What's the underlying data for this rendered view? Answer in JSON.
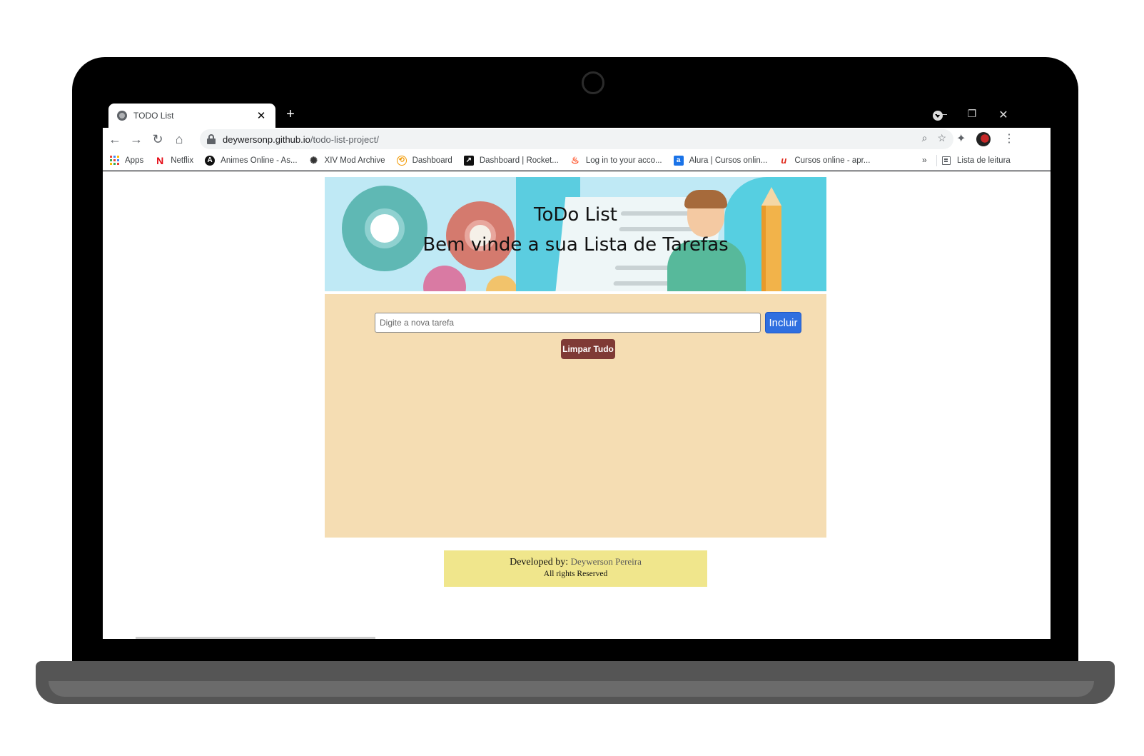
{
  "browser": {
    "tab_title": "TODO List",
    "url_host": "deywersonp.github.io",
    "url_path": "/todo-list-project/",
    "bookmarks": [
      {
        "label": "Apps",
        "icon": "apps-grid-icon"
      },
      {
        "label": "Netflix",
        "icon": "netflix-icon",
        "color": "#e50914"
      },
      {
        "label": "Animes Online - As...",
        "icon": "anime-icon",
        "color": "#111111"
      },
      {
        "label": "XIV Mod Archive",
        "icon": "mod-archive-icon",
        "color": "#555555"
      },
      {
        "label": "Dashboard",
        "icon": "dashboard-icon",
        "color": "#f29900"
      },
      {
        "label": "Dashboard | Rocket...",
        "icon": "rocketseat-icon",
        "color": "#111111"
      },
      {
        "label": "Log in to your acco...",
        "icon": "flame-icon",
        "color": "#ff4b1f"
      },
      {
        "label": "Alura | Cursos onlin...",
        "icon": "alura-icon",
        "color": "#1a73e8"
      },
      {
        "label": "Cursos online - apr...",
        "icon": "udemy-icon",
        "color": "#e0281b"
      }
    ],
    "more_bookmarks": "»",
    "reading_list": "Lista de leitura"
  },
  "banner": {
    "title": "ToDo List",
    "subtitle": "Bem vinde a sua Lista de Tarefas"
  },
  "todo": {
    "input_placeholder": "Digite a nova tarefa",
    "input_value": "",
    "add_label": "Incluir",
    "clear_label": "Limpar Tudo"
  },
  "footer": {
    "developed_by": "Developed by:",
    "author": "Deywerson Pereira",
    "rights": "All rights Reserved"
  },
  "colors": {
    "panel_bg": "#f5ddb3",
    "add_button": "#2f6fe0",
    "clear_button": "#7f3a35",
    "footer_bg": "#f0e68c",
    "banner_bg": "#bfe9f5"
  }
}
